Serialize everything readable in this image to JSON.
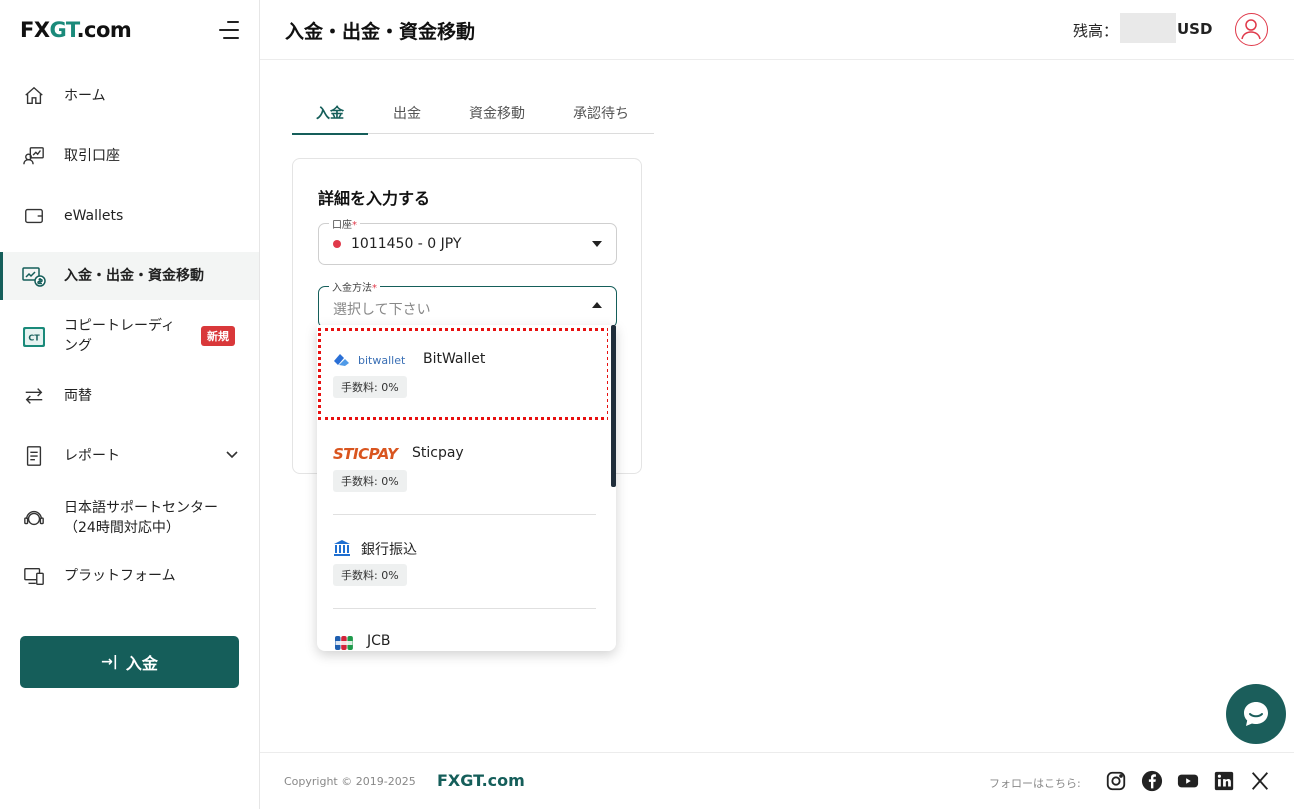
{
  "brand": {
    "logo_fx": "FX",
    "logo_gt": "GT",
    "logo_suffix": ".com",
    "accent": "#155e5a",
    "danger": "#e0394a"
  },
  "sidebar": {
    "items": [
      {
        "label": "ホーム",
        "icon": "home-icon"
      },
      {
        "label": "取引口座",
        "icon": "trading-account-icon"
      },
      {
        "label": "eWallets",
        "icon": "wallet-icon"
      },
      {
        "label": "入金・出金・資金移動",
        "icon": "funds-icon",
        "active": true
      },
      {
        "label": "コピートレーディ\nング",
        "icon": "copy-trading-icon",
        "badge": "新規"
      },
      {
        "label": "両替",
        "icon": "exchange-icon"
      },
      {
        "label": "レポート",
        "icon": "report-icon"
      },
      {
        "label": "日本語サポートセンター\n（24時間対応中）",
        "icon": "support-icon"
      },
      {
        "label": "プラットフォーム",
        "icon": "platform-icon"
      }
    ],
    "deposit_button": "入金"
  },
  "header": {
    "title": "入金・出金・資金移動",
    "balance_label": "残高：",
    "balance_currency": "USD"
  },
  "tabs": [
    {
      "label": "入金",
      "active": true
    },
    {
      "label": "出金"
    },
    {
      "label": "資金移動"
    },
    {
      "label": "承認待ち"
    }
  ],
  "form": {
    "title": "詳細を入力する",
    "account": {
      "label": "口座",
      "required": "*",
      "value": "1011450 - 0 JPY"
    },
    "method": {
      "label": "入金方法",
      "required": "*",
      "placeholder": "選択して下さい"
    }
  },
  "dropdown": {
    "options": [
      {
        "logo": "bitwallet",
        "name": "BitWallet",
        "fee": "手数料: 0%"
      },
      {
        "logo": "STICPAY",
        "name": "Sticpay",
        "fee": "手数料: 0%"
      },
      {
        "logo": "bank-icon",
        "name": "銀行振込",
        "fee": "手数料: 0%"
      },
      {
        "logo": "jcb-icon",
        "name": "JCB"
      }
    ]
  },
  "footer": {
    "copyright": "Copyright © 2019-2025",
    "brand": "FXGT.com",
    "follow": "フォローはこちら:",
    "social": [
      "instagram-icon",
      "facebook-icon",
      "youtube-icon",
      "linkedin-icon",
      "x-icon"
    ]
  }
}
